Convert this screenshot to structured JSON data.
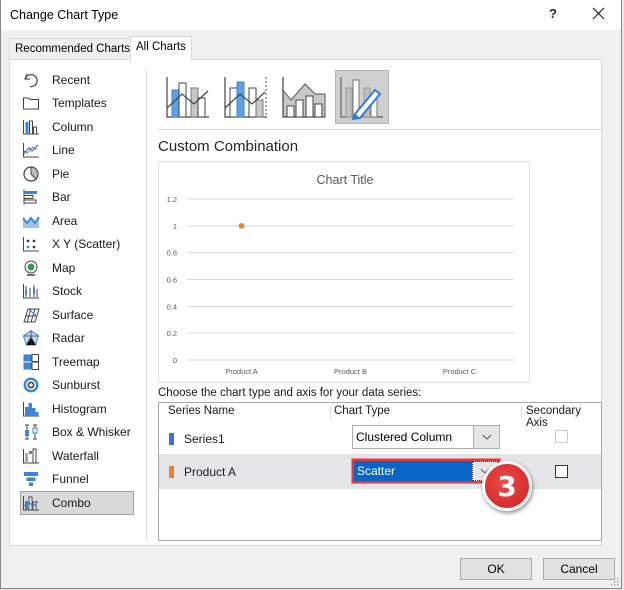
{
  "window": {
    "title": "Change Chart Type",
    "help_label": "?",
    "close_icon": "close-icon"
  },
  "tabs": [
    {
      "label": "Recommended Charts",
      "active": false
    },
    {
      "label": "All Charts",
      "active": true
    }
  ],
  "sidebar": {
    "items": [
      {
        "label": "Recent",
        "icon": "recent-icon"
      },
      {
        "label": "Templates",
        "icon": "templates-folder-icon"
      },
      {
        "label": "Column",
        "icon": "column-chart-icon"
      },
      {
        "label": "Line",
        "icon": "line-chart-icon"
      },
      {
        "label": "Pie",
        "icon": "pie-chart-icon"
      },
      {
        "label": "Bar",
        "icon": "bar-chart-icon"
      },
      {
        "label": "Area",
        "icon": "area-chart-icon"
      },
      {
        "label": "X Y (Scatter)",
        "icon": "scatter-chart-icon"
      },
      {
        "label": "Map",
        "icon": "map-chart-icon"
      },
      {
        "label": "Stock",
        "icon": "stock-chart-icon"
      },
      {
        "label": "Surface",
        "icon": "surface-chart-icon"
      },
      {
        "label": "Radar",
        "icon": "radar-chart-icon"
      },
      {
        "label": "Treemap",
        "icon": "treemap-chart-icon"
      },
      {
        "label": "Sunburst",
        "icon": "sunburst-chart-icon"
      },
      {
        "label": "Histogram",
        "icon": "histogram-chart-icon"
      },
      {
        "label": "Box & Whisker",
        "icon": "box-whisker-chart-icon"
      },
      {
        "label": "Waterfall",
        "icon": "waterfall-chart-icon"
      },
      {
        "label": "Funnel",
        "icon": "funnel-chart-icon"
      },
      {
        "label": "Combo",
        "icon": "combo-chart-icon",
        "selected": true
      }
    ]
  },
  "combo_subtypes": [
    {
      "name": "clustered-column-line",
      "selected": false
    },
    {
      "name": "clustered-column-line-secondary-axis",
      "selected": false
    },
    {
      "name": "stacked-area-clustered-column",
      "selected": false
    },
    {
      "name": "custom-combination",
      "selected": true
    }
  ],
  "main": {
    "section_title": "Custom Combination",
    "series_prompt": "Choose the chart type and axis for your data series:"
  },
  "chart_data": {
    "type": "scatter",
    "title": "Chart Title",
    "categories": [
      "Product A",
      "Product B",
      "Product C"
    ],
    "y_ticks": [
      "0",
      "0.2",
      "0.4",
      "0.6",
      "0.8",
      "1",
      "1.2"
    ],
    "ylim": [
      0,
      1.2
    ],
    "grid": true,
    "series": [
      {
        "name": "Product A",
        "color": "#ed7d31",
        "points": [
          {
            "x": "Product A",
            "y": 1
          }
        ]
      }
    ],
    "xlabel": "",
    "ylabel": ""
  },
  "series_table": {
    "headers": {
      "name": "Series Name",
      "type": "Chart Type",
      "axis": "Secondary Axis"
    },
    "rows": [
      {
        "name": "Series1",
        "color": "#4472c4",
        "chart_type": "Clustered Column",
        "secondary_axis": false,
        "axis_enabled": false,
        "selected": false
      },
      {
        "name": "Product A",
        "color": "#ed7d31",
        "chart_type": "Scatter",
        "secondary_axis": false,
        "axis_enabled": true,
        "selected": true
      }
    ]
  },
  "annotation": {
    "step_badge": "3",
    "badge_color": "#d92b2b"
  },
  "buttons": {
    "ok": "OK",
    "cancel": "Cancel"
  }
}
